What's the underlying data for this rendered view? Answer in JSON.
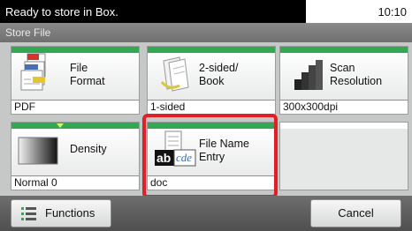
{
  "status": {
    "message": "Ready to store in Box.",
    "time": "10:10"
  },
  "screen_title": "Store File",
  "tiles": [
    {
      "label_line1": "File",
      "label_line2": "Format",
      "value": "PDF",
      "icon": "file-format-icon"
    },
    {
      "label_line1": "2-sided/",
      "label_line2": "Book",
      "value": "1-sided",
      "icon": "duplex-book-icon"
    },
    {
      "label_line1": "Scan",
      "label_line2": "Resolution",
      "value": "300x300dpi",
      "icon": "scan-resolution-icon"
    },
    {
      "label_line1": "Density",
      "label_line2": "",
      "value": "Normal 0",
      "icon": "density-icon"
    },
    {
      "label_line1": "File Name",
      "label_line2": "Entry",
      "value": "doc",
      "icon": "file-name-entry-icon",
      "glyphs": [
        "ab",
        "cde"
      ]
    }
  ],
  "buttons": {
    "functions": "Functions",
    "cancel": "Cancel"
  },
  "colors": {
    "accent_stripe": "#33a853",
    "highlight": "#e21f26"
  }
}
